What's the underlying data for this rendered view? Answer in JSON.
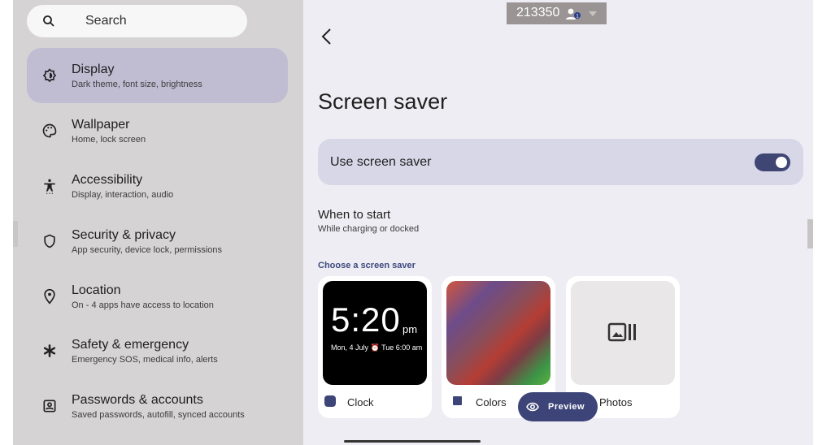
{
  "search": {
    "placeholder": "Search",
    "icon": "search-icon"
  },
  "sidebar": {
    "items": [
      {
        "title": "Display",
        "subtitle": "Dark theme, font size, brightness",
        "icon": "display-brightness-icon",
        "selected": true
      },
      {
        "title": "Wallpaper",
        "subtitle": "Home, lock screen",
        "icon": "palette-icon"
      },
      {
        "title": "Accessibility",
        "subtitle": "Display, interaction, audio",
        "icon": "accessibility-icon"
      },
      {
        "title": "Security & privacy",
        "subtitle": "App security, device lock, permissions",
        "icon": "shield-icon"
      },
      {
        "title": "Location",
        "subtitle": "On - 4 apps have access to location",
        "icon": "location-pin-icon"
      },
      {
        "title": "Safety & emergency",
        "subtitle": "Emergency SOS, medical info, alerts",
        "icon": "asterisk-icon"
      },
      {
        "title": "Passwords & accounts",
        "subtitle": "Saved passwords, autofill, synced accounts",
        "icon": "account-box-icon"
      }
    ]
  },
  "top_chip": {
    "value": "213350",
    "icon": "people-icon"
  },
  "main": {
    "title": "Screen saver",
    "toggle": {
      "label": "Use screen saver",
      "on": true
    },
    "when": {
      "title": "When to start",
      "subtitle": "While charging or docked"
    },
    "section_label": "Choose a screen saver",
    "savers": [
      {
        "name": "Clock",
        "time": "5:20",
        "period": "pm",
        "date": "Mon, 4 July  ⏰ Tue 6:00 am"
      },
      {
        "name": "Colors"
      },
      {
        "name": "Photos",
        "icon": "photo-album-icon"
      }
    ],
    "preview": {
      "label": "Preview",
      "icon": "eye-icon"
    }
  },
  "colors": {
    "accent": "#3d4478",
    "selected_bg": "#c0bdd3",
    "card_bg": "#d8d7e8"
  }
}
